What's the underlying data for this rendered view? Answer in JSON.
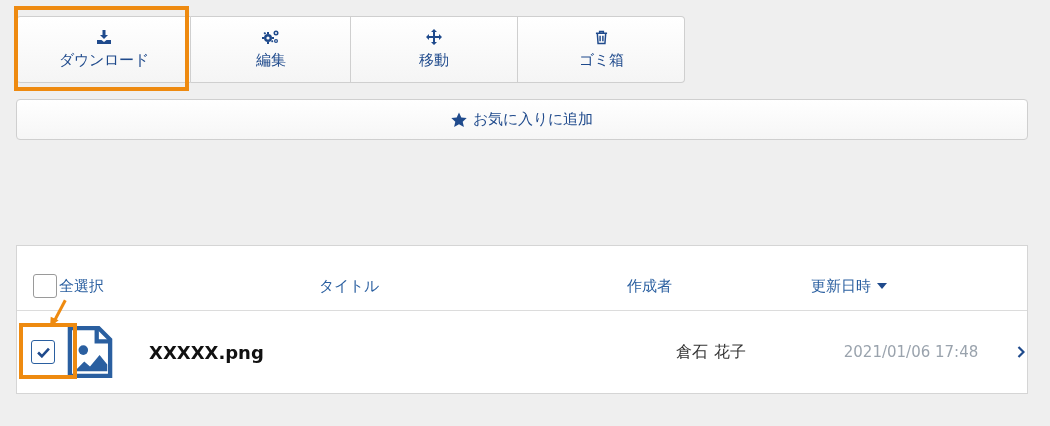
{
  "toolbar": [
    {
      "label": "ダウンロード",
      "highlighted": true
    },
    {
      "label": "編集",
      "highlighted": false
    },
    {
      "label": "移動",
      "highlighted": false
    },
    {
      "label": "ゴミ箱",
      "highlighted": false
    }
  ],
  "favorite_button": {
    "label": "お気に入りに追加"
  },
  "table": {
    "select_all": {
      "label": "全選択",
      "checked": false
    },
    "columns": [
      {
        "label": "タイトル",
        "sorted": false
      },
      {
        "label": "作成者",
        "sorted": false
      },
      {
        "label": "更新日時",
        "sorted": true
      }
    ],
    "rows": [
      {
        "checked": true,
        "highlighted": true,
        "title": "XXXXX.png",
        "author": "倉石 花子",
        "updated": "2021/01/06 17:48"
      }
    ]
  }
}
